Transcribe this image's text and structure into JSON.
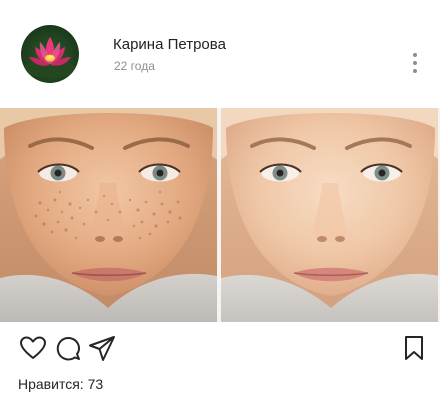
{
  "post": {
    "author": {
      "name": "Карина Петрова",
      "subtitle": "22 года",
      "avatar_icon": "lotus-flower-icon"
    },
    "media": {
      "panels": [
        "before-photo",
        "after-photo"
      ]
    },
    "actions": {
      "like_icon": "heart-icon",
      "comment_icon": "comment-icon",
      "share_icon": "send-icon",
      "save_icon": "bookmark-icon",
      "more_icon": "more-vertical-icon"
    },
    "likes_label": "Нравится:",
    "likes_count": "73"
  },
  "colors": {
    "text": "#262626",
    "muted": "#8e8e8e",
    "icon": "#262626"
  }
}
